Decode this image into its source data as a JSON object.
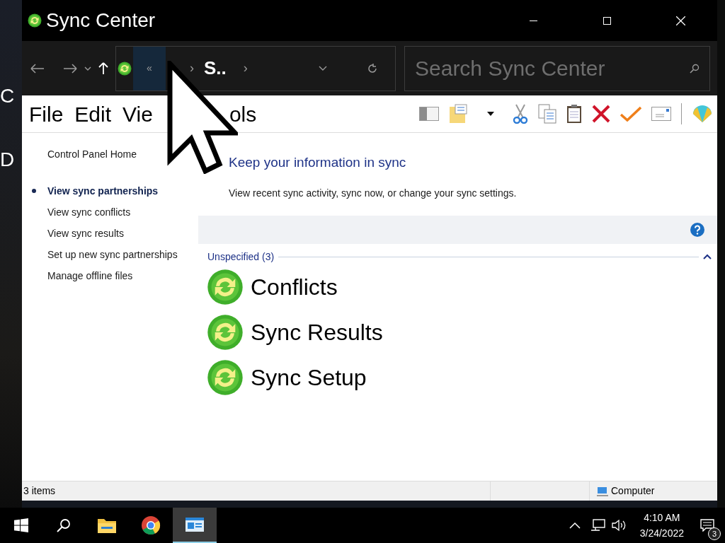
{
  "desktop": {
    "labels": [
      "C",
      "D"
    ]
  },
  "window": {
    "title": "Sync Center"
  },
  "address": {
    "overflow": "«",
    "crumbs": [
      "S.."
    ],
    "separator": "›"
  },
  "search": {
    "placeholder": "Search Sync Center"
  },
  "menu": [
    "File",
    "Edit",
    "Vie",
    "ols"
  ],
  "sidebar": {
    "home": "Control Panel Home",
    "links": [
      {
        "label": "View sync partnerships",
        "selected": true
      },
      {
        "label": "View sync conflicts",
        "selected": false
      },
      {
        "label": "View sync results",
        "selected": false
      },
      {
        "label": "Set up new sync partnerships",
        "selected": false
      },
      {
        "label": "Manage offline files",
        "selected": false
      }
    ]
  },
  "content": {
    "heading": "Keep your information in sync",
    "description": "View recent sync activity, sync now, or change your sync settings.",
    "group": {
      "label": "Unspecified (3)",
      "expanded": true
    },
    "items": [
      "Conflicts",
      "Sync Results",
      "Sync Setup"
    ]
  },
  "status_bar": {
    "count": "3 items",
    "location": "Computer"
  },
  "taskbar": {
    "apps": [
      {
        "kind": "explorer",
        "selected": false
      },
      {
        "kind": "chrome",
        "selected": false
      },
      {
        "kind": "sync",
        "selected": true
      }
    ],
    "time": "4:10 AM",
    "date": "3/24/2022",
    "notifications": "3"
  }
}
